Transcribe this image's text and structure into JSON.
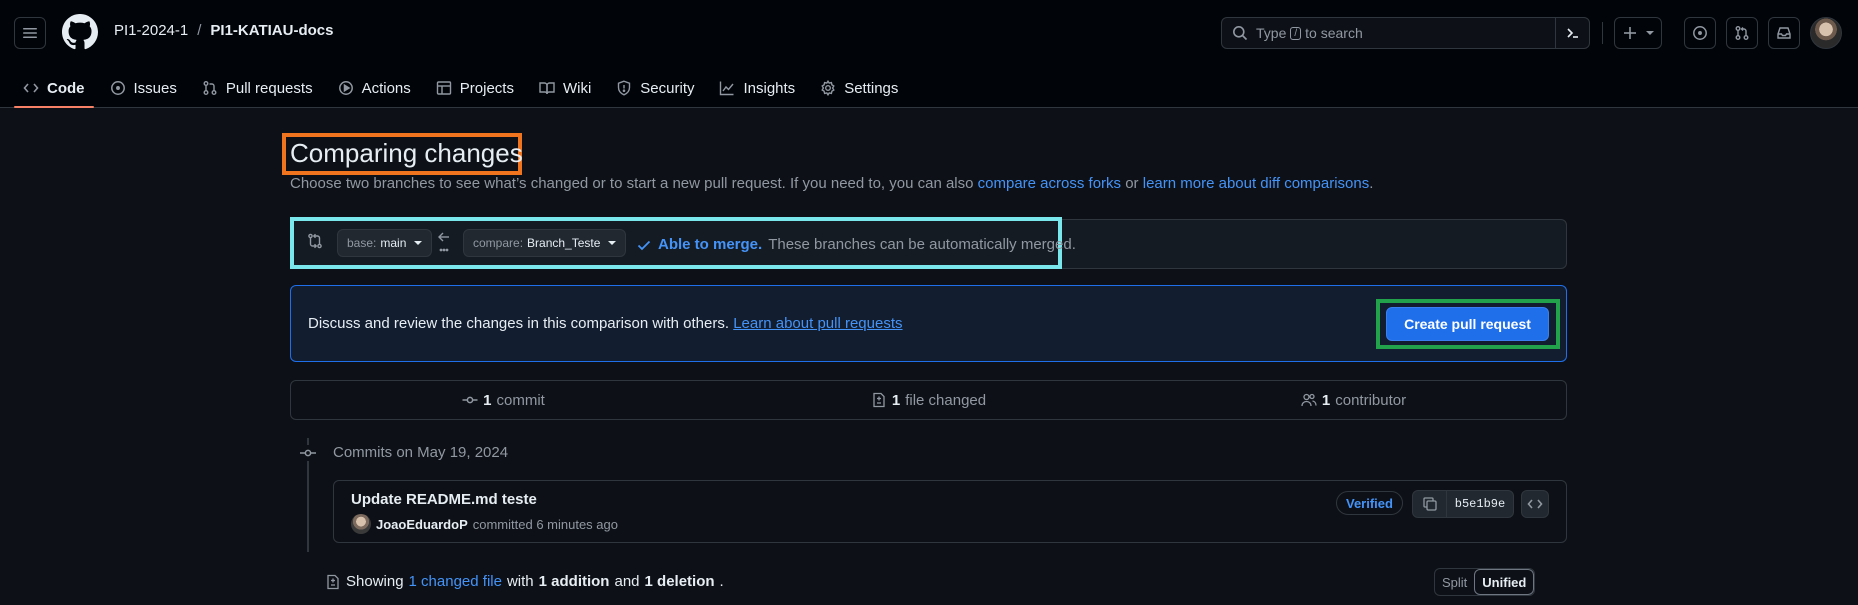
{
  "repo": {
    "owner": "PI1-2024-1",
    "separator": "/",
    "name": "PI1-KATIAU-docs"
  },
  "search": {
    "text_before": "Type",
    "key": "/",
    "text_after": "to search"
  },
  "tabs": [
    {
      "label": "Code",
      "icon": "code-icon"
    },
    {
      "label": "Issues",
      "icon": "issue-opened-icon"
    },
    {
      "label": "Pull requests",
      "icon": "git-pull-request-icon"
    },
    {
      "label": "Actions",
      "icon": "play-icon"
    },
    {
      "label": "Projects",
      "icon": "table-icon"
    },
    {
      "label": "Wiki",
      "icon": "book-icon"
    },
    {
      "label": "Security",
      "icon": "shield-icon"
    },
    {
      "label": "Insights",
      "icon": "graph-icon"
    },
    {
      "label": "Settings",
      "icon": "gear-icon"
    }
  ],
  "compare": {
    "title": "Comparing changes",
    "subtitle_prefix": "Choose two branches to see what’s changed or to start a new pull request. If you need to, you can also",
    "link_forks": "compare across forks",
    "subtitle_or": "or",
    "link_learn": "learn more about diff comparisons",
    "subtitle_end": ".",
    "base_label": "base:",
    "base_value": "main",
    "compare_label": "compare:",
    "compare_value": "Branch_Teste",
    "merge_able": "Able to merge.",
    "merge_text": "These branches can be automatically merged."
  },
  "banner": {
    "text": "Discuss and review the changes in this comparison with others.",
    "link": "Learn about pull requests",
    "button": "Create pull request"
  },
  "stats": {
    "commits_count": "1",
    "commits_label": "commit",
    "files_count": "1",
    "files_label": "file changed",
    "contributors_count": "1",
    "contributors_label": "contributor"
  },
  "commits": {
    "heading": "Commits on May 19, 2024",
    "message": "Update README.md teste",
    "author": "JoaoEduardoP",
    "time": "committed 6 minutes ago",
    "verified": "Verified",
    "sha": "b5e1b9e"
  },
  "summary": {
    "showing": "Showing",
    "files_link": "1 changed file",
    "with": "with",
    "additions": "1 addition",
    "and": "and",
    "deletions": "1 deletion",
    "end": ".",
    "split": "Split",
    "unified": "Unified"
  },
  "colors": {
    "accent": "#4493f8",
    "tab_underline": "#f78166",
    "primary_button": "#1f6feb",
    "highlight_orange": "#f0731d",
    "highlight_cyan": "#79e7ec",
    "highlight_green": "#22a34b"
  }
}
